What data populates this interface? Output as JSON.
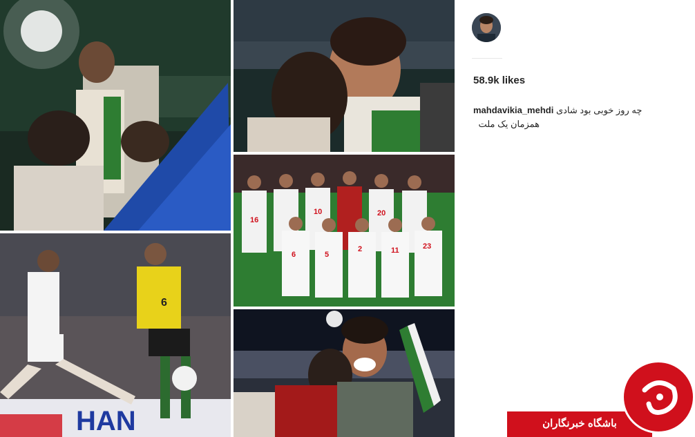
{
  "post": {
    "likes": "58.9k likes",
    "username": "mahdavikia_mehdi",
    "caption_line1": "چه روز خوبی بود شادی",
    "caption_line2": "همزمان یک ملت"
  },
  "players_back": [
    "16",
    "10",
    "20",
    "6"
  ],
  "players_front": [
    "6",
    "5",
    "2",
    "11",
    "23"
  ],
  "match_player_number": "6",
  "banner_text": "HAN",
  "watermark": {
    "text": "باشگاه خبرنگاران"
  },
  "colors": {
    "accent_red": "#d0101c",
    "pitch_green": "#2e7d32",
    "kit_yellow": "#e8d21a"
  }
}
